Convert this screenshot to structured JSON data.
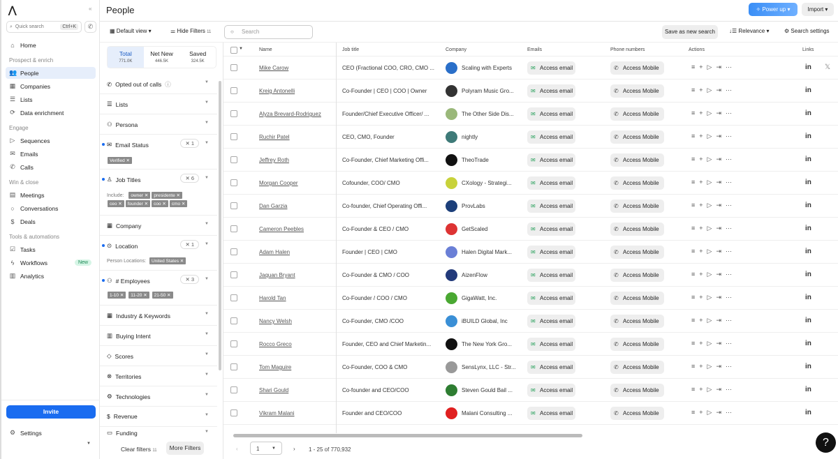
{
  "sidebar": {
    "quick_search": "Quick search",
    "shortcut": "Ctrl+K",
    "home": "Home",
    "sec_prospect": "Prospect & enrich",
    "people": "People",
    "companies": "Companies",
    "lists": "Lists",
    "enrichment": "Data enrichment",
    "sec_engage": "Engage",
    "sequences": "Sequences",
    "emails": "Emails",
    "calls": "Calls",
    "sec_win": "Win & close",
    "meetings": "Meetings",
    "conversations": "Conversations",
    "deals": "Deals",
    "sec_tools": "Tools & automations",
    "tasks": "Tasks",
    "workflows": "Workflows",
    "new_badge": "New",
    "analytics": "Analytics",
    "invite": "Invite",
    "settings": "Settings"
  },
  "header": {
    "title": "People",
    "power_up": "Power up",
    "import": "Import"
  },
  "toolbar": {
    "default_view": "Default view",
    "hide_filters": "Hide Filters",
    "filter_count": "11",
    "search_placeholder": "Search",
    "save_search": "Save as new search",
    "relevance": "Relevance",
    "search_settings": "Search settings"
  },
  "filters": {
    "tabs": [
      {
        "label": "Total",
        "count": "771.0K"
      },
      {
        "label": "Net New",
        "count": "446.5K"
      },
      {
        "label": "Saved",
        "count": "324.5K"
      }
    ],
    "opted_out": "Opted out of calls",
    "lists": "Lists",
    "persona": "Persona",
    "email_status": "Email Status",
    "email_status_count": "1",
    "email_chips": [
      "Verified"
    ],
    "job_titles": "Job Titles",
    "job_titles_count": "6",
    "include_label": "Include:",
    "job_chips": [
      "owner",
      "presidente",
      "ceo",
      "founder",
      "coo",
      "cmo"
    ],
    "company": "Company",
    "location": "Location",
    "location_count": "1",
    "person_locations_label": "Person Locations:",
    "location_chips": [
      "United States"
    ],
    "employees": "# Employees",
    "employees_count": "3",
    "employee_chips": [
      "1-10",
      "11-20",
      "21-50"
    ],
    "industry": "Industry & Keywords",
    "buying_intent": "Buying Intent",
    "scores": "Scores",
    "territories": "Territories",
    "technologies": "Technologies",
    "revenue": "Revenue",
    "funding": "Funding",
    "clear_filters": "Clear filters",
    "clear_count": "11",
    "more_filters": "More Filters"
  },
  "table": {
    "columns": {
      "name": "Name",
      "job": "Job title",
      "company": "Company",
      "emails": "Emails",
      "phones": "Phone numbers",
      "actions": "Actions",
      "links": "Links"
    },
    "access_email": "Access email",
    "access_mobile": "Access Mobile",
    "rows": [
      {
        "name": "Mike Carow",
        "job": "CEO (Fractional COO, CRO, CMO ...",
        "company": "Scaling with Experts",
        "logo": "#2a6fc9",
        "x": true
      },
      {
        "name": "Kreig Antonelli",
        "job": "Co-Founder | CEO | COO | Owner",
        "company": "Polyram Music Gro...",
        "logo": "#333"
      },
      {
        "name": "Alyza Brevard-Rodriguez",
        "job": "Founder/Chief Executive Officer/ ...",
        "company": "The Other Side Dis...",
        "logo": "#9ab87a"
      },
      {
        "name": "Ruchir Patel",
        "job": "CEO, CMO, Founder",
        "company": "nightly",
        "logo": "#3e7a78"
      },
      {
        "name": "Jeffrey Roth",
        "job": "Co-Founder, Chief Marketing Offi...",
        "company": "TheoTrade",
        "logo": "#111"
      },
      {
        "name": "Morgan Cooper",
        "job": "Cofounder, COO/ CMO",
        "company": "CXology - Strategi...",
        "logo": "#c8d23a"
      },
      {
        "name": "Dan Garzia",
        "job": "Co-founder, Chief Operating Offi...",
        "company": "ProvLabs",
        "logo": "#1c3f7a"
      },
      {
        "name": "Cameron Peebles",
        "job": "Co-Founder & CEO / CMO",
        "company": "GetScaled",
        "logo": "#d33"
      },
      {
        "name": "Adam Halen",
        "job": "Founder | CEO | CMO",
        "company": "Halen Digital Mark...",
        "logo": "#6a7fd6"
      },
      {
        "name": "Jaquan Bryant",
        "job": "Co-Founder & CMO / COO",
        "company": "AizenFlow",
        "logo": "#223a7a"
      },
      {
        "name": "Harold Tan",
        "job": "Co-Founder / COO / CMO",
        "company": "GigaWatt, Inc.",
        "logo": "#4aa832"
      },
      {
        "name": "Nancy Welsh",
        "job": "Co-Founder, CMO /COO",
        "company": "iBUILD Global, Inc",
        "logo": "#3a8fd6"
      },
      {
        "name": "Rocco Greco",
        "job": "Founder, CEO and Chief Marketin...",
        "company": "The New York Gro...",
        "logo": "#111"
      },
      {
        "name": "Tom Maguire",
        "job": "Co-Founder, COO & CMO",
        "company": "SensLynx, LLC - Str...",
        "logo": "#999"
      },
      {
        "name": "Shari Gould",
        "job": "Co-founder and CEO/COO",
        "company": "Steven Gould Bail ...",
        "logo": "#2e7d32"
      },
      {
        "name": "Vikram Malani",
        "job": "Founder and CEO/COO",
        "company": "Malani Consulting ...",
        "logo": "#e02020"
      }
    ]
  },
  "pager": {
    "page": "1",
    "range": "1 - 25 of 770,932"
  }
}
